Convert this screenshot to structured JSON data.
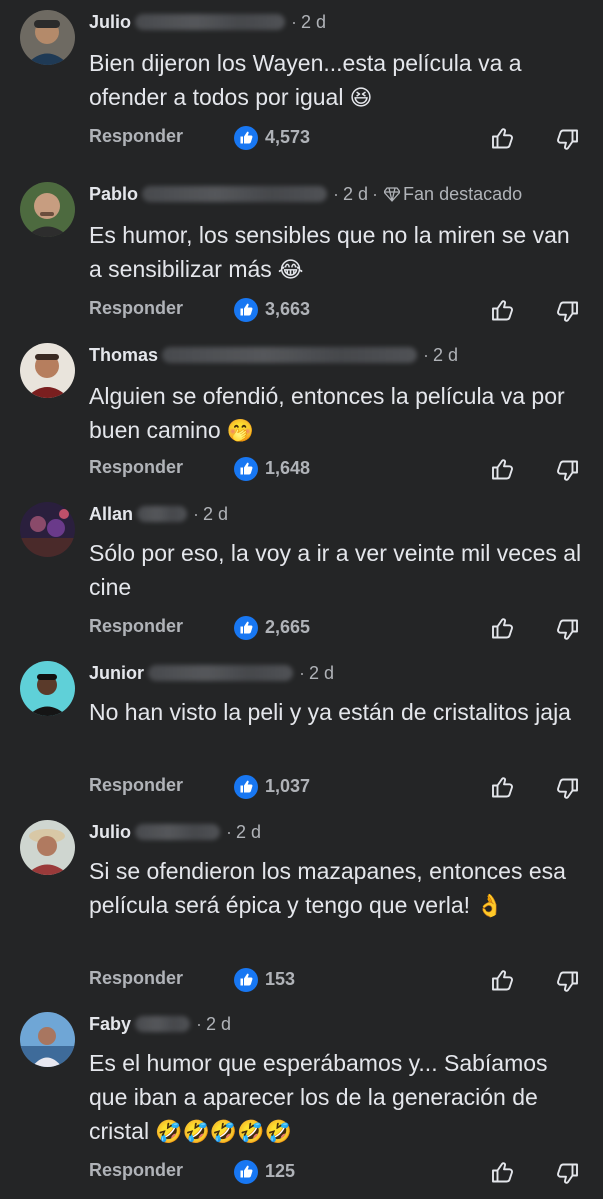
{
  "colors": {
    "background": "#242526",
    "like_blue": "#1877f2",
    "secondary_text": "#b0b3b8"
  },
  "comments": [
    {
      "author": "Julio",
      "time": "2 d",
      "badge": "",
      "text": "Bien dijeron los Wayen...esta película va a ofender a todos por igual",
      "emoji": "😆",
      "reply": "Responder",
      "likes": "4,573"
    },
    {
      "author": "Pablo",
      "time": "2 d",
      "badge": "Fan destacado",
      "text": "Es humor, los sensibles que no la miren se van a sensibilizar más",
      "emoji": "😂",
      "reply": "Responder",
      "likes": "3,663"
    },
    {
      "author": "Thomas",
      "time": "2 d",
      "badge": "",
      "text": "Alguien se ofendió, entonces la película va por buen camino",
      "emoji": "🤭",
      "reply": "Responder",
      "likes": "1,648"
    },
    {
      "author": "Allan",
      "time": "2 d",
      "badge": "",
      "text": "Sólo por eso, la voy a ir a ver veinte mil veces al cine",
      "emoji": "",
      "reply": "Responder",
      "likes": "2,665"
    },
    {
      "author": "Junior",
      "time": "2 d",
      "badge": "",
      "text": "No han visto la peli y ya están de cristalitos jaja",
      "emoji": "",
      "reply": "Responder",
      "likes": "1,037"
    },
    {
      "author": "Julio",
      "time": "2 d",
      "badge": "",
      "text": "Si se ofendieron los mazapanes, entonces esa película será épica y tengo que verla!",
      "emoji": "👌",
      "reply": "Responder",
      "likes": "153"
    },
    {
      "author": "Faby",
      "time": "2 d",
      "badge": "",
      "text": "Es el humor que esperábamos y... Sabíamos que iban a aparecer los de la generación de cristal",
      "emoji": "🤣🤣🤣🤣🤣",
      "reply": "Responder",
      "likes": "125"
    }
  ]
}
